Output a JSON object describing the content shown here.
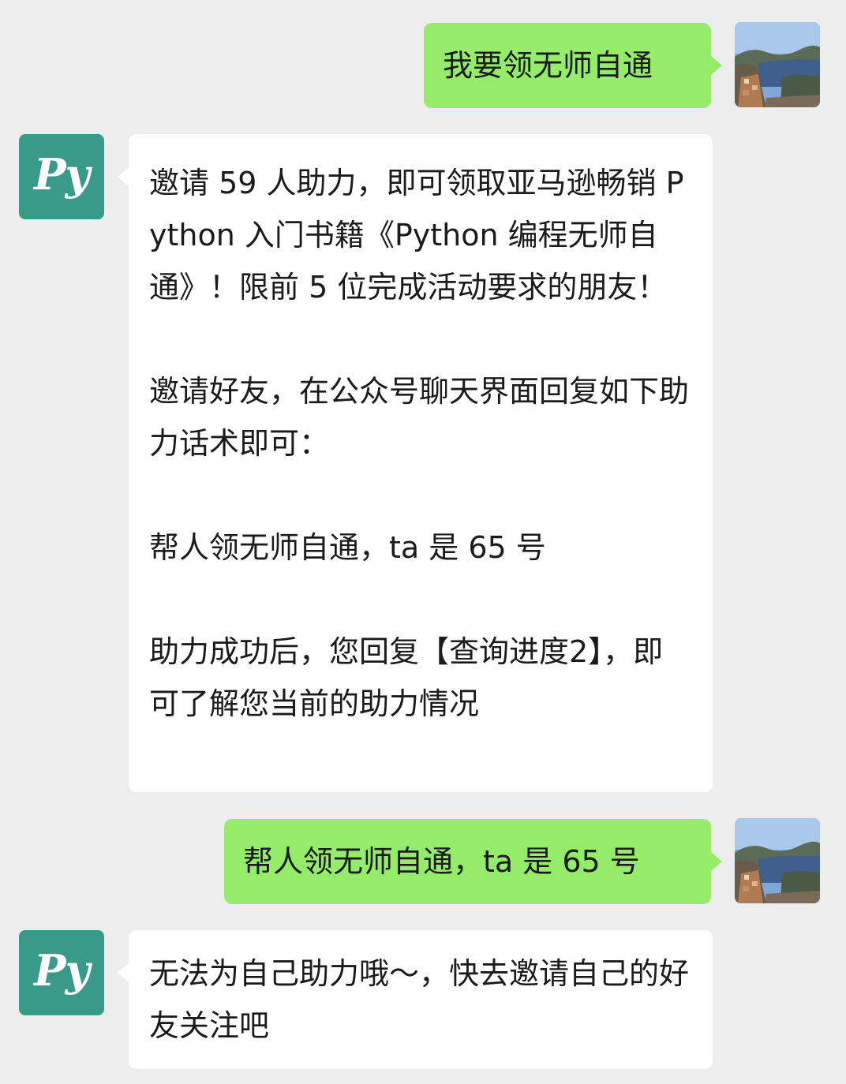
{
  "messages": [
    {
      "sender": "user",
      "text": "我要领无师自通"
    },
    {
      "sender": "bot",
      "avatar_text": "Py",
      "text": "邀请 59 人助力，即可领取亚马逊畅销 Python 入门书籍《Python 编程无师自通》！限前 5 位完成活动要求的朋友！\n\n邀请好友，在公众号聊天界面回复如下助力话术即可：\n\n帮人领无师自通，ta 是 65 号\n\n助力成功后，您回复【查询进度2】，即可了解您当前的助力情况"
    },
    {
      "sender": "user",
      "text": "帮人领无师自通，ta 是 65 号"
    },
    {
      "sender": "bot",
      "avatar_text": "Py",
      "text": "无法为自己助力哦～，快去邀请自己的好友关注吧"
    }
  ],
  "colors": {
    "background": "#ededed",
    "user_bubble": "#95ec69",
    "bot_bubble": "#ffffff",
    "bot_avatar": "#3a9a8a"
  },
  "icons": {
    "user_avatar": "landscape-photo-avatar",
    "bot_avatar": "py-logo-avatar"
  }
}
